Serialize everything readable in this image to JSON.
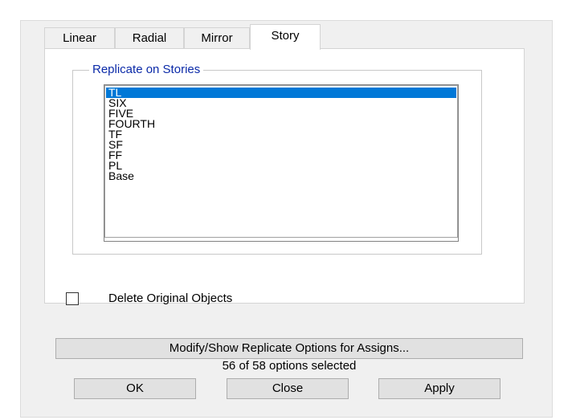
{
  "tabs": [
    {
      "label": "Linear"
    },
    {
      "label": "Radial"
    },
    {
      "label": "Mirror"
    },
    {
      "label": "Story"
    }
  ],
  "active_tab": "Story",
  "group": {
    "title": "Replicate on Stories"
  },
  "stories": {
    "items": [
      "TL",
      "SIX",
      "FIVE",
      "FOURTH",
      "TF",
      "SF",
      "FF",
      "PL",
      "Base"
    ],
    "selected": "TL"
  },
  "delete_original": {
    "label": "Delete Original Objects",
    "checked": false
  },
  "modify_button": {
    "label": "Modify/Show Replicate Options for Assigns..."
  },
  "status": {
    "text": "56 of 58 options selected"
  },
  "buttons": {
    "ok": "OK",
    "close": "Close",
    "apply": "Apply"
  },
  "colors": {
    "selection": "#0078d7",
    "group_title": "#0b2aa8",
    "dialog_bg": "#f0f0f0"
  }
}
